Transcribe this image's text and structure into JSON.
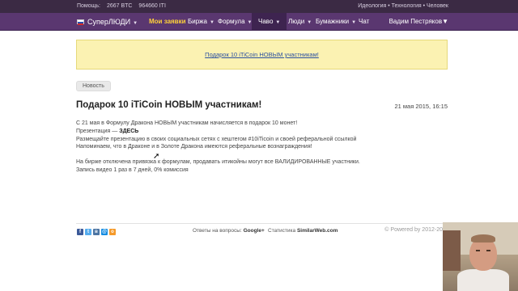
{
  "topbar": {
    "help": "Помощь:",
    "btc": "2667 BTC",
    "iti": "964660 ITI",
    "tagline": "Идеология • Технология • Человек"
  },
  "nav": {
    "brand": "СуперЛЮДИ",
    "items": [
      {
        "label": "Мои заявки"
      },
      {
        "label": "Биржа"
      },
      {
        "label": "Формула"
      },
      {
        "label": "Чаво"
      },
      {
        "label": "Люди"
      },
      {
        "label": "Бумажники"
      },
      {
        "label": "Чат"
      }
    ],
    "user": "Вадим Пестряков"
  },
  "banner": {
    "link": "Подарок 10 iTiCoin НОВЫМ участникам!"
  },
  "post": {
    "tag": "Новость",
    "title": "Подарок 10 iTiCoin НОВЫМ участникам!",
    "date": "21 мая 2015, 16:15",
    "lines": [
      "С 21 мая в Формулу Дракона НОВЫМ участникам начисляется в подарок 10 монет!",
      "Презентация — ",
      "Размещайте презентацию в своих социальных сетях с хештегом #10iTicoin и своей реферальной ссылкой",
      "Напоминаем, что в Драконе и в Золоте Дракона имеются реферальные вознаграждения!",
      "На бирже отключена привязка к формулам, продавать итикойны могут все ВАЛИДИРОВАННЫЕ участники.",
      "Запись видео 1 раз в 7 дней, 0% комиссия"
    ],
    "here": "ЗДЕСЬ"
  },
  "footer": {
    "questions_prefix": "Ответы на вопросы:",
    "questions_link": "Google+",
    "stats_prefix": "Статистика",
    "stats_link": "SimilarWeb.com",
    "copyright": "© Powered by 2012-20"
  },
  "colors": {
    "topbar": "#3b2a44",
    "nav": "#5a3770",
    "active": "#ffd23a",
    "banner": "#fbf2b2",
    "link": "#2b50a0"
  }
}
